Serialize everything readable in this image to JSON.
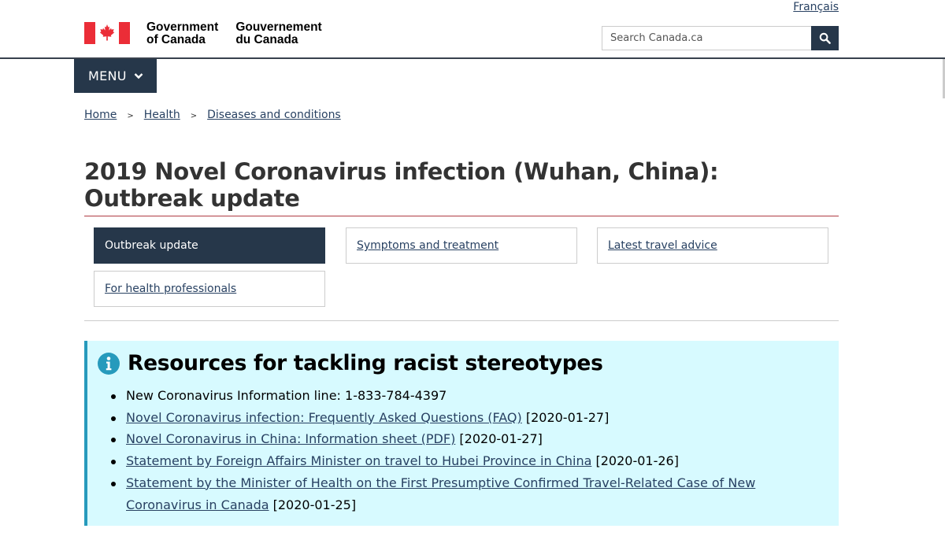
{
  "language_toggle": {
    "label": "Français"
  },
  "header": {
    "signature_en": [
      "Government",
      "of Canada"
    ],
    "signature_fr": [
      "Gouvernement",
      "du Canada"
    ],
    "search": {
      "placeholder": "Search Canada.ca",
      "button_icon": "search-icon"
    }
  },
  "menu": {
    "label": "MENU",
    "icon": "chevron-down-icon"
  },
  "breadcrumb": {
    "items": [
      "Home",
      "Health",
      "Diseases and conditions"
    ],
    "separator": ">"
  },
  "page": {
    "title": "2019 Novel Coronavirus infection (Wuhan, China): Outbreak update"
  },
  "tabs": [
    {
      "label": "Outbreak update",
      "active": true
    },
    {
      "label": "Symptoms and treatment",
      "active": false
    },
    {
      "label": "Latest travel advice",
      "active": false
    },
    {
      "label": "For health professionals",
      "active": false
    }
  ],
  "alert": {
    "icon": "info-icon",
    "heading": "Resources for tackling racist stereotypes",
    "items": [
      {
        "text": "New Coronavirus Information line: 1-833-784-4397",
        "link": "",
        "date": ""
      },
      {
        "text": "",
        "link": "Novel Coronavirus infection: Frequently Asked Questions (FAQ)",
        "date": "[2020-01-27]"
      },
      {
        "text": "",
        "link": "Novel Coronavirus in China: Information sheet (PDF)",
        "date": "[2020-01-27]"
      },
      {
        "text": "",
        "link": "Statement by Foreign Affairs Minister on travel to Hubei Province in China",
        "date": "[2020-01-26]"
      },
      {
        "text": "",
        "link": "Statement by the Minister of Health on the First Presumptive Confirmed Travel-Related Case of New Coronavirus in Canada",
        "date": "[2020-01-25]"
      }
    ]
  },
  "colors": {
    "primary_dark": "#26374a",
    "link": "#284162",
    "flag_red": "#eb2d37",
    "title_rule": "#af3c43",
    "alert_bg": "#d7faff",
    "alert_border": "#269abc"
  }
}
